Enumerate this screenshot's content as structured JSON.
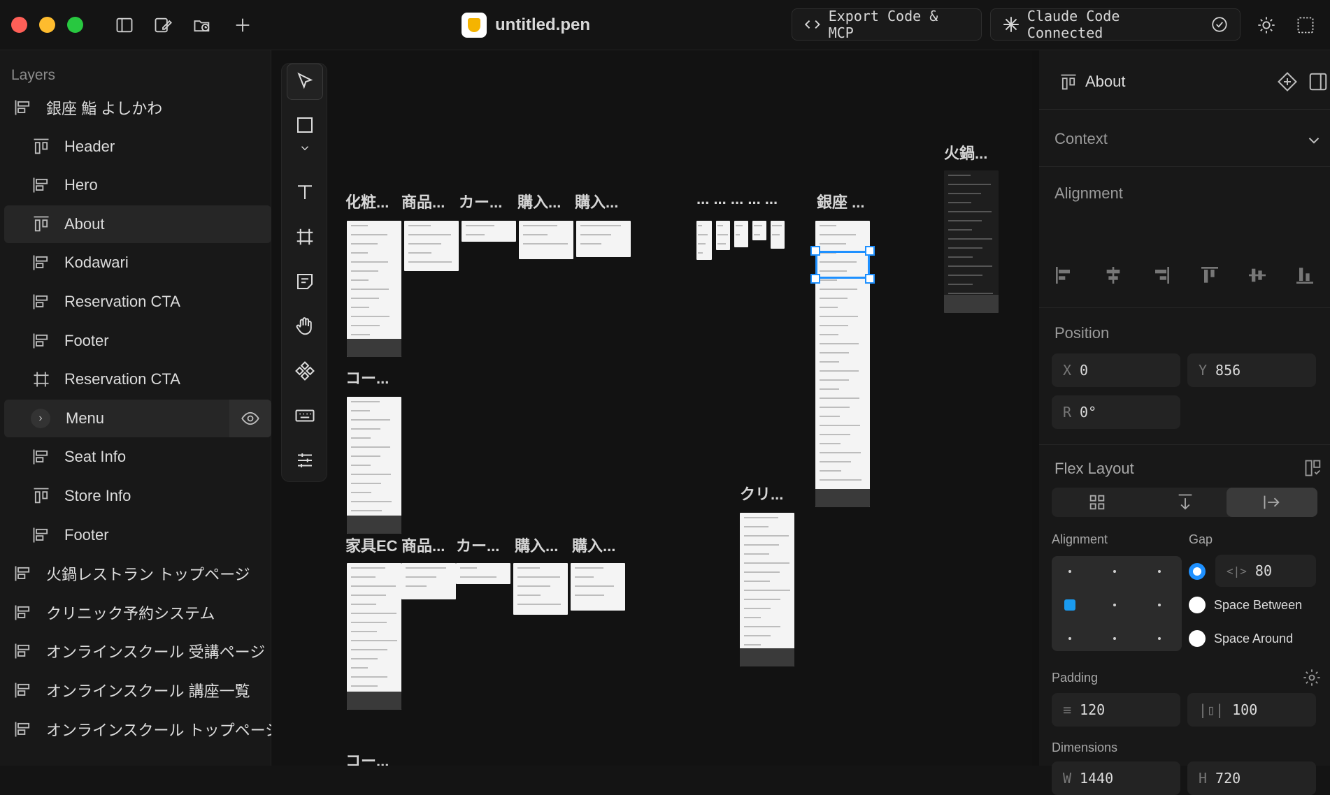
{
  "topbar": {
    "file_name": "untitled.pen",
    "export_label": "Export Code & MCP",
    "claude_label": "Claude Code Connected",
    "traffic_colors": [
      "#ff5f57",
      "#febc2e",
      "#28c840"
    ]
  },
  "layers": {
    "title": "Layers",
    "items": [
      {
        "label": "銀座 鮨 よしかわ",
        "icon": "stack-icon",
        "indent": 0
      },
      {
        "label": "Header",
        "icon": "column-icon",
        "indent": 1
      },
      {
        "label": "Hero",
        "icon": "stack-icon",
        "indent": 1
      },
      {
        "label": "About",
        "icon": "column-icon",
        "indent": 1,
        "selected": true
      },
      {
        "label": "Kodawari",
        "icon": "stack-icon",
        "indent": 1
      },
      {
        "label": "Reservation CTA",
        "icon": "stack-icon",
        "indent": 1
      },
      {
        "label": "Footer",
        "icon": "stack-icon",
        "indent": 1
      },
      {
        "label": "Reservation CTA",
        "icon": "frame-icon",
        "indent": 1
      },
      {
        "label": "Menu",
        "icon": "chevron-icon",
        "indent": 1,
        "hover": true
      },
      {
        "label": "Seat Info",
        "icon": "stack-icon",
        "indent": 1
      },
      {
        "label": "Store Info",
        "icon": "column-icon",
        "indent": 1
      },
      {
        "label": "Footer",
        "icon": "stack-icon",
        "indent": 1
      },
      {
        "label": "火鍋レストラン トップページ",
        "icon": "stack-icon",
        "indent": 0
      },
      {
        "label": "クリニック予約システム",
        "icon": "stack-icon",
        "indent": 0
      },
      {
        "label": "オンラインスクール 受講ページ",
        "icon": "stack-icon",
        "indent": 0
      },
      {
        "label": "オンラインスクール 講座一覧",
        "icon": "stack-icon",
        "indent": 0
      },
      {
        "label": "オンラインスクール トップページ",
        "icon": "stack-icon",
        "indent": 0
      }
    ]
  },
  "canvas": {
    "labels": [
      "化粧...",
      "商品...",
      "カー...",
      "購入...",
      "購入...",
      "... ... ... ... ...",
      "銀座 ...",
      "火鍋...",
      "コー...",
      "家具EC",
      "商品...",
      "カー...",
      "購入...",
      "購入...",
      "クリ...",
      "コー..."
    ]
  },
  "props": {
    "title": "About",
    "context": "Context",
    "alignment": "Alignment",
    "position": "Position",
    "x": {
      "prefix": "X",
      "value": "0"
    },
    "y": {
      "prefix": "Y",
      "value": "856"
    },
    "r": {
      "prefix": "R",
      "value": "0°"
    },
    "flex_layout": "Flex Layout",
    "align_label": "Alignment",
    "gap_label": "Gap",
    "gap_value": "80",
    "space_between": "Space Between",
    "space_around": "Space Around",
    "padding_label": "Padding",
    "padding_v": "120",
    "padding_h": "100",
    "dimensions_label": "Dimensions",
    "w": {
      "prefix": "W",
      "value": "1440"
    },
    "h": {
      "prefix": "H",
      "value": "720"
    },
    "accent": "#1e90ff",
    "selected_dot": "#1a9bf0"
  }
}
